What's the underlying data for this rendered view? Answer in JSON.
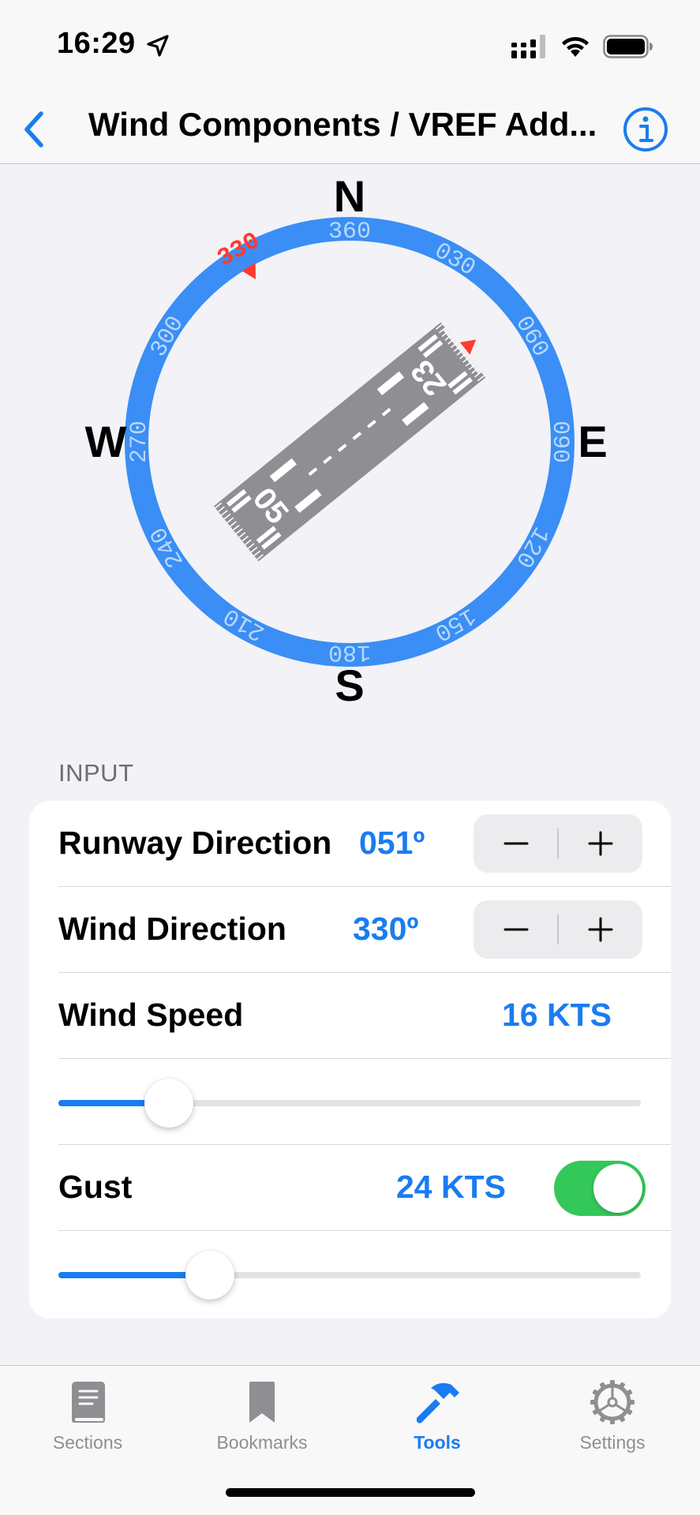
{
  "status": {
    "time": "16:29",
    "location_icon": "location-arrow-icon",
    "signal_icon": "cellular-signal-icon",
    "wifi_icon": "wifi-icon",
    "battery_icon": "battery-icon"
  },
  "nav": {
    "title": "Wind Components / VREF Add...",
    "back_icon": "chevron-left-icon",
    "info_icon": "info-circle-icon"
  },
  "compass": {
    "cardinals": {
      "n": "N",
      "e": "E",
      "s": "S",
      "w": "W"
    },
    "headings": [
      "360",
      "030",
      "060",
      "090",
      "120",
      "150",
      "180",
      "210",
      "240",
      "270",
      "300",
      "330"
    ],
    "wind_heading_label": "330",
    "runway_numbers": {
      "start": "05",
      "end": "23"
    },
    "runway_heading_deg": 51,
    "wind_heading_deg": 330,
    "colors": {
      "ring": "#3a8ef5",
      "ring_text": "#b9d8fb",
      "wind": "#ff3b30",
      "runway": "#8e8e93"
    }
  },
  "input": {
    "header": "INPUT",
    "runway_direction": {
      "label": "Runway Direction",
      "value": "051º"
    },
    "wind_direction": {
      "label": "Wind Direction",
      "value": "330º"
    },
    "wind_speed": {
      "label": "Wind Speed",
      "value": "16 KTS",
      "slider_fraction": 0.19
    },
    "gust": {
      "label": "Gust",
      "value": "24 KTS",
      "enabled": true,
      "slider_fraction": 0.26
    },
    "stepper": {
      "minus": "−",
      "plus": "+"
    }
  },
  "tabs": [
    {
      "label": "Sections",
      "icon": "book-icon",
      "active": false
    },
    {
      "label": "Bookmarks",
      "icon": "bookmark-icon",
      "active": false
    },
    {
      "label": "Tools",
      "icon": "hammer-icon",
      "active": true
    },
    {
      "label": "Settings",
      "icon": "gear-icon",
      "active": false
    }
  ],
  "colors": {
    "accent": "#1a7cf0",
    "toggle_on": "#34c759",
    "background": "#f2f2f7"
  }
}
